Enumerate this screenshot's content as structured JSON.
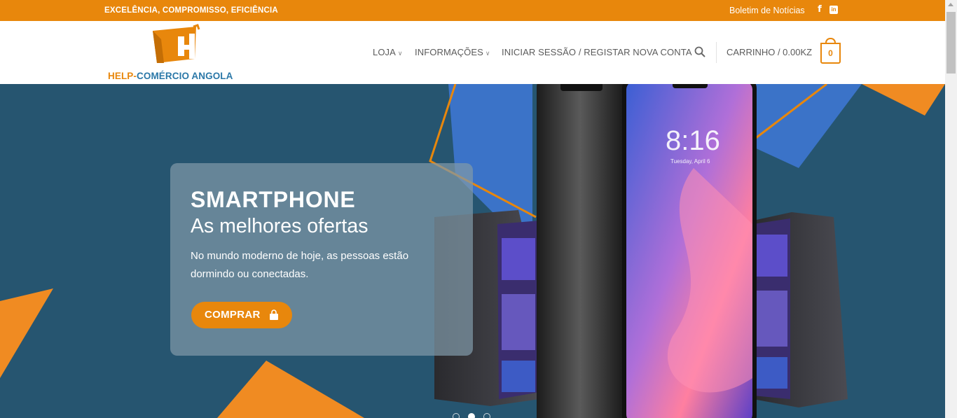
{
  "topbar": {
    "tagline": "EXCELÊNCIA, COMPROMISSO, EFICIÊNCIA",
    "newsletter": "Boletim de Notícias",
    "facebook": "f",
    "linkedin": "in",
    "background": "#e8870c"
  },
  "header": {
    "logo": {
      "part1": "HELP-",
      "part2": "COMÉRCIO ANGOLA"
    },
    "nav": {
      "loja": "LOJA",
      "informacoes": "INFORMAÇÕES",
      "login": "INICIAR SESSÃO / REGISTAR NOVA CONTA"
    },
    "cart_label": "CARRINHO / 0.00KZ",
    "cart_count": "0"
  },
  "hero": {
    "title": "SMARTPHONE",
    "subtitle": "As melhores ofertas",
    "text": "No mundo moderno de hoje, as pessoas estão dormindo ou conectadas.",
    "button": "COMPRAR",
    "phone_time": "8:16",
    "phone_date": "Tuesday, April 6",
    "active_slide": 2,
    "slide_count": 3
  },
  "colors": {
    "accent": "#e8870c",
    "brand_blue": "#2b78a8",
    "hero_bg": "#265570"
  }
}
